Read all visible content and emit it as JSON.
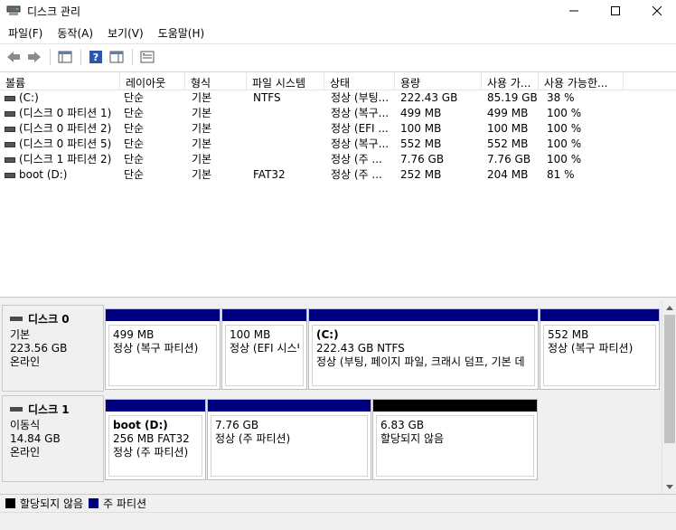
{
  "window": {
    "title": "디스크 관리"
  },
  "menu": [
    "파일(F)",
    "동작(A)",
    "보기(V)",
    "도움말(H)"
  ],
  "columns": [
    "볼륨",
    "레이아웃",
    "형식",
    "파일 시스템",
    "상태",
    "용량",
    "사용 가...",
    "사용 가능한..."
  ],
  "volumes": [
    {
      "name": "(C:)",
      "layout": "단순",
      "type": "기본",
      "fs": "NTFS",
      "status": "정상 (부팅...",
      "capacity": "222.43 GB",
      "free": "85.19 GB",
      "pct": "38 %"
    },
    {
      "name": "(디스크 0 파티션 1)",
      "layout": "단순",
      "type": "기본",
      "fs": "",
      "status": "정상 (복구...",
      "capacity": "499 MB",
      "free": "499 MB",
      "pct": "100 %"
    },
    {
      "name": "(디스크 0 파티션 2)",
      "layout": "단순",
      "type": "기본",
      "fs": "",
      "status": "정상 (EFI ...",
      "capacity": "100 MB",
      "free": "100 MB",
      "pct": "100 %"
    },
    {
      "name": "(디스크 0 파티션 5)",
      "layout": "단순",
      "type": "기본",
      "fs": "",
      "status": "정상 (복구...",
      "capacity": "552 MB",
      "free": "552 MB",
      "pct": "100 %"
    },
    {
      "name": "(디스크 1 파티션 2)",
      "layout": "단순",
      "type": "기본",
      "fs": "",
      "status": "정상 (주 ...",
      "capacity": "7.76 GB",
      "free": "7.76 GB",
      "pct": "100 %"
    },
    {
      "name": "boot (D:)",
      "layout": "단순",
      "type": "기본",
      "fs": "FAT32",
      "status": "정상 (주 ...",
      "capacity": "252 MB",
      "free": "204 MB",
      "pct": "81 %"
    }
  ],
  "disks": [
    {
      "name": "디스크 0",
      "kind": "기본",
      "size": "223.56 GB",
      "state": "온라인",
      "partitions": [
        {
          "title": "",
          "size": "499 MB",
          "status": "정상 (복구 파티션)",
          "color": "#00007f"
        },
        {
          "title": "",
          "size": "100 MB",
          "status": "정상 (EFI 시스템",
          "color": "#00007f"
        },
        {
          "title": "(C:)",
          "size": "222.43 GB NTFS",
          "status": "정상 (부팅, 페이지 파일, 크래시 덤프, 기본 데",
          "color": "#00007f"
        },
        {
          "title": "",
          "size": "552 MB",
          "status": "정상 (복구 파티션)",
          "color": "#00007f"
        }
      ]
    },
    {
      "name": "디스크 1",
      "kind": "이동식",
      "size": "14.84 GB",
      "state": "온라인",
      "partitions": [
        {
          "title": "boot  (D:)",
          "size": "256 MB FAT32",
          "status": "정상 (주 파티션)",
          "color": "#00007f"
        },
        {
          "title": "",
          "size": "7.76 GB",
          "status": "정상 (주 파티션)",
          "color": "#00007f"
        },
        {
          "title": "",
          "size": "6.83 GB",
          "status": "할당되지 않음",
          "color": "#000000"
        }
      ]
    }
  ],
  "legend": [
    {
      "label": "할당되지 않음",
      "color": "#000000"
    },
    {
      "label": "주 파티션",
      "color": "#00007f"
    }
  ]
}
